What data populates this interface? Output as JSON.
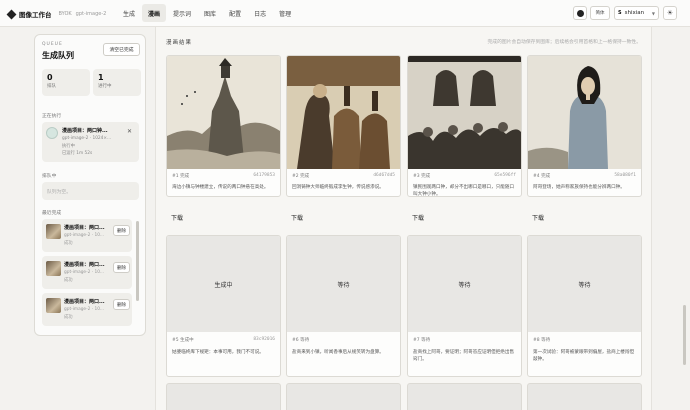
{
  "app": {
    "name": "图像工作台",
    "sub": "BYOK",
    "model": "gpt-image-2"
  },
  "nav": [
    {
      "label": "生成",
      "active": false
    },
    {
      "label": "漫画",
      "active": true
    },
    {
      "label": "提示词",
      "active": false
    },
    {
      "label": "图库",
      "active": false
    },
    {
      "label": "配置",
      "active": false
    },
    {
      "label": "日志",
      "active": false
    },
    {
      "label": "管理",
      "active": false
    }
  ],
  "topbar": {
    "github_icon": "github-icon",
    "lang_label": "简体",
    "avatar_letter": "S",
    "username": "shixian",
    "theme_icon": "sun-icon"
  },
  "queue": {
    "eyebrow": "QUEUE",
    "title": "生成队列",
    "clear_label": "清空已完成",
    "stats": [
      {
        "num": "0",
        "label": "排队"
      },
      {
        "num": "1",
        "label": "进行中"
      }
    ],
    "running_title": "正在执行",
    "running_item": {
      "title": "漫画项目：两口钟...",
      "line1": "gpt-image-2 · 1024×...",
      "line2": "执行中",
      "line3": "已运行 1m 52s"
    },
    "waiting_title": "排队中",
    "waiting_empty": "队列为空。",
    "done_title": "最近完成",
    "done_items": [
      {
        "title": "漫画项目：两口...",
        "line1": "gpt-image-2 · 10...",
        "line2": "成功",
        "delete_label": "删除"
      },
      {
        "title": "漫画项目：两口...",
        "line1": "gpt-image-2 · 10...",
        "line2": "成功",
        "delete_label": "删除"
      },
      {
        "title": "漫画项目：两口...",
        "line1": "gpt-image-2 · 10...",
        "line2": "成功",
        "delete_label": "删除"
      }
    ]
  },
  "main": {
    "title": "漫画结果",
    "note": "完成的图片会自动保存到图库；后续格会引用首格和上一格保持一致性。",
    "cards": [
      {
        "label": "#1 完成",
        "hash": "64179853",
        "desc": "海边小镇与钟楼建立，传说的两口钟悬在高处。",
        "download": "下载",
        "scene": "tower"
      },
      {
        "label": "#2 完成",
        "hash": "d6d67dd5",
        "desc": "回洞铸钟大师临终锻成李生钟，传说感渗说。",
        "download": "下载",
        "scene": "bells"
      },
      {
        "label": "#3 完成",
        "hash": "65e596ff",
        "desc": "镇民围观两口钟，却分不出哪口是哪口，只能随口叫大钟小钟。",
        "download": "下载",
        "scene": "crowd"
      },
      {
        "label": "#4 完成",
        "hash": "58a080f1",
        "desc": "阿哥登场，她声称家族保持也能分辨两口钟。",
        "download": "下载",
        "scene": "woman"
      },
      {
        "label": "#5 生成中",
        "hash": "83c92016",
        "status_text": "生成中",
        "desc": "姑婆临终库下规矩：本事可用，我门不可说。"
      },
      {
        "label": "#6 等待",
        "hash": "",
        "status_text": "等待",
        "desc": "盐商来到小镇，听闻香事后从规笑转为盘算。"
      },
      {
        "label": "#7 等待",
        "hash": "",
        "status_text": "等待",
        "desc": "盐商找上阿哥，要证明；阿哥答应证明但拒绝出售窍门。"
      },
      {
        "label": "#8 等待",
        "hash": "",
        "status_text": "等待",
        "desc": "第一次试验：阿哥被蒙眼带到偏屋，盐商上楼闯但敲钟。"
      }
    ]
  }
}
